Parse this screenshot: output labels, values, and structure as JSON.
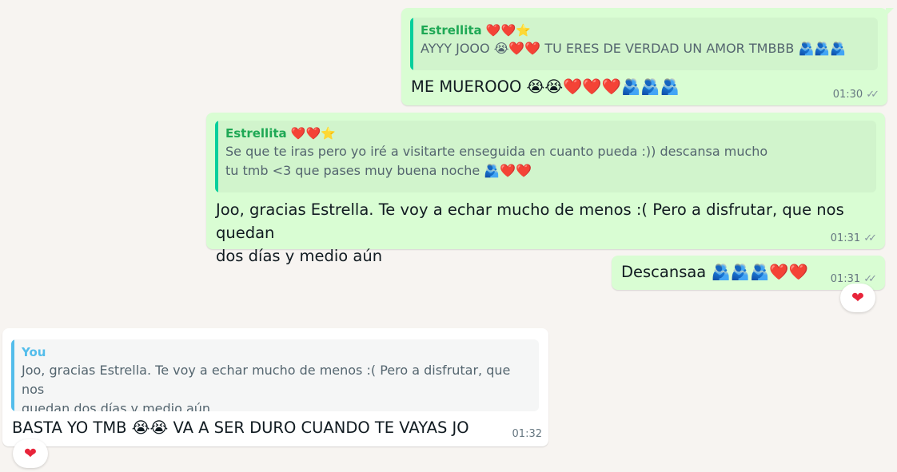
{
  "messages": [
    {
      "quote_author": "Estrellita ❤️❤️⭐",
      "quote_text": "AYYY JOOO 😭❤️❤️ TU ERES DE VERDAD UN AMOR TMBBB 🫂🫂🫂",
      "text": "ME MUEROOO 😭😭❤️❤️❤️🫂🫂🫂",
      "time": "01:30"
    },
    {
      "quote_author": "Estrellita ❤️❤️⭐",
      "quote_text": "Se que te iras pero yo iré a visitarte enseguida en cuanto pueda :)) descansa mucho\ntu tmb <3 que pases muy buena noche 🫂❤️❤️",
      "text": "Joo, gracias Estrella. Te voy a echar mucho de menos :( Pero a disfrutar, que nos quedan\ndos días y medio aún",
      "time": "01:31"
    },
    {
      "text": "Descansaa 🫂🫂🫂❤️❤️",
      "time": "01:31",
      "reaction": "❤"
    },
    {
      "quote_author": "You",
      "quote_text": "Joo, gracias Estrella. Te voy a echar mucho de menos :( Pero a disfrutar, que nos\nquedan dos días y medio aún",
      "text": "BASTA YO TMB 😭😭 VA A SER DURO CUANDO TE VAYAS JO",
      "time": "01:32",
      "reaction": "❤"
    }
  ],
  "colors": {
    "outgoing_bubble": "#d9fdd3",
    "incoming_bubble": "#ffffff",
    "quote_bar_contact": "#06cf9c",
    "quote_bar_you": "#53bdeb",
    "background": "#f7f4f1"
  },
  "icons": {
    "read_receipt": "double-check-icon",
    "reaction": "heart-icon"
  }
}
